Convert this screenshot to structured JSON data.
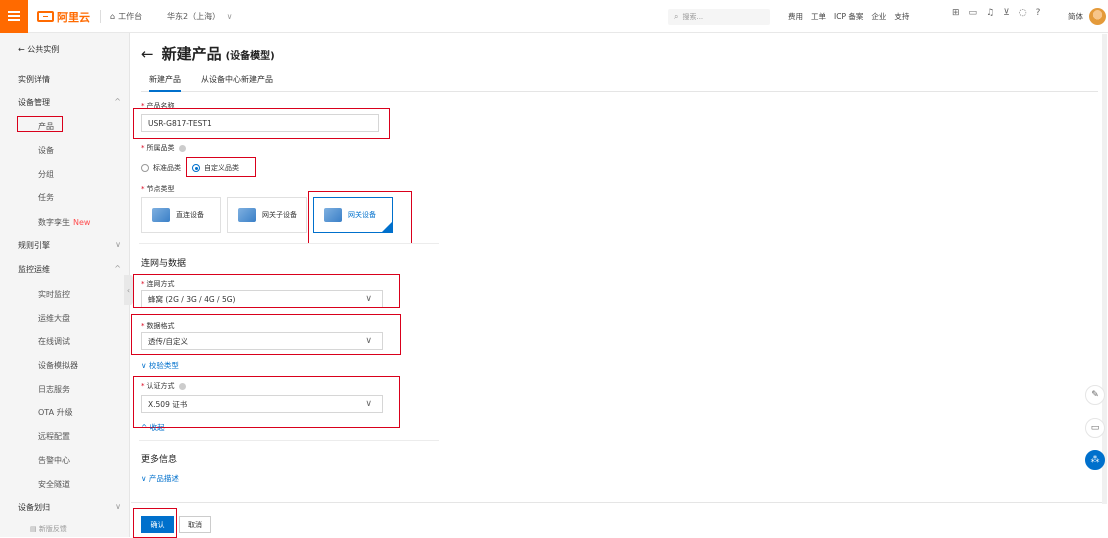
{
  "topbar": {
    "logo_text": "阿里云",
    "workbench": "工作台",
    "region": "华东2（上海）",
    "search_placeholder": "搜索...",
    "links": [
      "费用",
      "工单",
      "ICP 备案",
      "企业",
      "支持"
    ],
    "lang": "简体"
  },
  "sidebar": {
    "back": "← 公共实例",
    "items": [
      {
        "label": "实例详情",
        "kind": "head"
      },
      {
        "label": "设备管理",
        "kind": "head",
        "arrow": "^"
      },
      {
        "label": "产品",
        "kind": "sub"
      },
      {
        "label": "设备",
        "kind": "sub"
      },
      {
        "label": "分组",
        "kind": "sub"
      },
      {
        "label": "任务",
        "kind": "sub"
      },
      {
        "label": "数字孪生",
        "kind": "sub",
        "badge": "New"
      },
      {
        "label": "规则引擎",
        "kind": "head",
        "arrow": "v"
      },
      {
        "label": "监控运维",
        "kind": "head",
        "arrow": "^"
      },
      {
        "label": "实时监控",
        "kind": "sub"
      },
      {
        "label": "运维大盘",
        "kind": "sub"
      },
      {
        "label": "在线调试",
        "kind": "sub"
      },
      {
        "label": "设备模拟器",
        "kind": "sub"
      },
      {
        "label": "日志服务",
        "kind": "sub"
      },
      {
        "label": "OTA 升级",
        "kind": "sub"
      },
      {
        "label": "远程配置",
        "kind": "sub"
      },
      {
        "label": "告警中心",
        "kind": "sub"
      },
      {
        "label": "安全隧道",
        "kind": "sub"
      },
      {
        "label": "设备划归",
        "kind": "head",
        "arrow": "v"
      }
    ],
    "feedback": "新版反馈"
  },
  "main": {
    "back_arrow": "←",
    "title": "新建产品",
    "title_sub": "(设备模型)",
    "tabs": [
      "新建产品",
      "从设备中心新建产品"
    ],
    "product_name_label": "产品名称",
    "product_name_value": "USR-G817-TEST1",
    "category_label": "所属品类",
    "category_options": [
      "标准品类",
      "自定义品类"
    ],
    "node_type_label": "节点类型",
    "node_types": [
      "直连设备",
      "网关子设备",
      "网关设备"
    ],
    "network_section": "连网与数据",
    "network_label": "连网方式",
    "network_value": "蜂窝 (2G / 3G / 4G / 5G)",
    "data_format_label": "数据格式",
    "data_format_value": "透传/自定义",
    "check_type_link": "校验类型",
    "auth_label": "认证方式",
    "auth_value": "X.509 证书",
    "collapse_link": "收起",
    "more_section": "更多信息",
    "desc_link": "产品描述",
    "confirm": "确认",
    "cancel": "取消"
  },
  "colors": {
    "brand": "#ff6a00",
    "primary": "#0070cc",
    "highlight": "#d9001b"
  }
}
